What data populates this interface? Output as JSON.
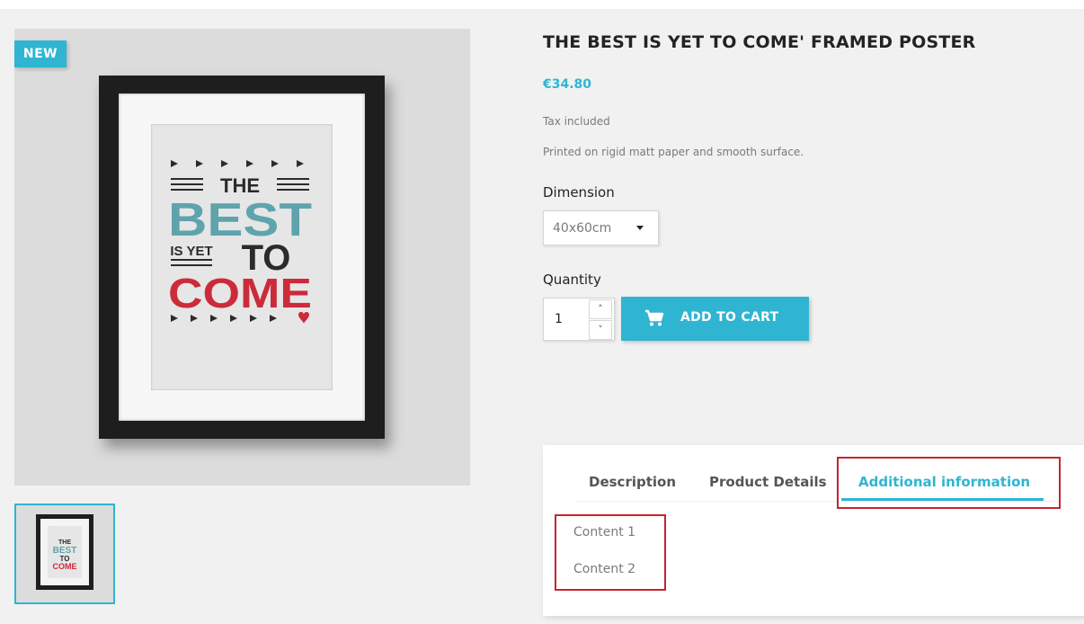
{
  "product": {
    "badge": "NEW",
    "title": "THE BEST IS YET TO COME' FRAMED POSTER",
    "price": "€34.80",
    "tax_note": "Tax included",
    "short_description": "Printed on rigid matt paper and smooth surface."
  },
  "poster_art": {
    "line1": "THE",
    "line2": "BEST",
    "line3_small": "IS YET",
    "line3_big": "TO",
    "line4": "COME",
    "colors": {
      "teal": "#5fa3ad",
      "red": "#cc2b3a",
      "dark": "#2b2b2b"
    }
  },
  "options": {
    "dimension_label": "Dimension",
    "dimension_value": "40x60cm",
    "quantity_label": "Quantity",
    "quantity_value": "1"
  },
  "cart": {
    "add_label": "ADD TO CART",
    "icon": "cart-icon"
  },
  "tabs": [
    {
      "label": "Description",
      "active": false
    },
    {
      "label": "Product Details",
      "active": false
    },
    {
      "label": "Additional information",
      "active": true
    }
  ],
  "tab_content": [
    "Content 1",
    "Content 2"
  ],
  "colors": {
    "accent": "#2fb5d2",
    "highlight": "#c8232f"
  }
}
